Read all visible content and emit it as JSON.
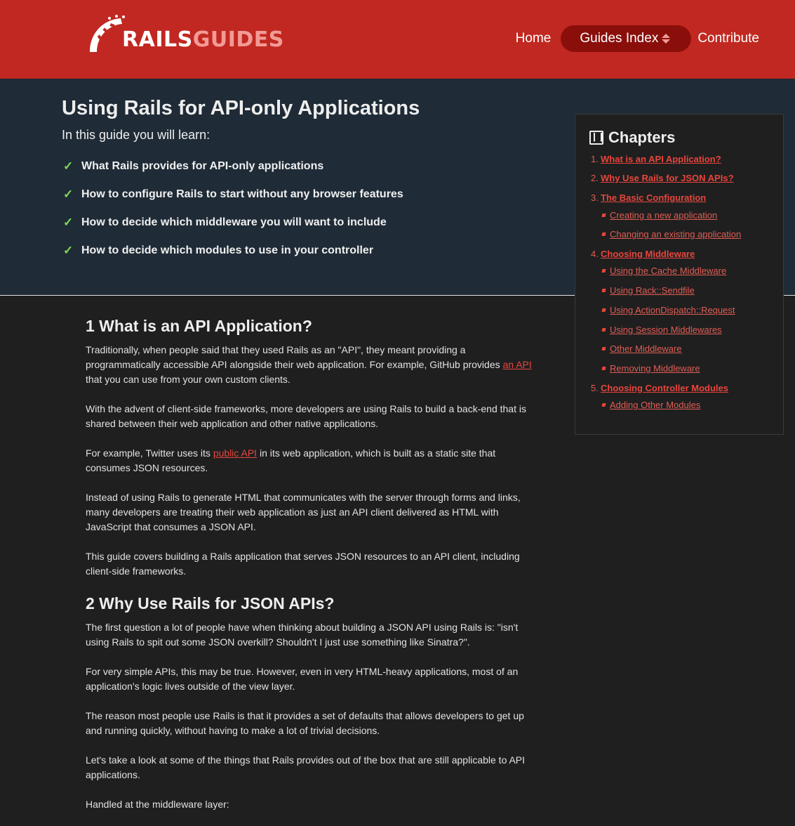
{
  "header": {
    "logo_rails": "RAILS",
    "logo_guides": "GUIDES",
    "nav": {
      "home": "Home",
      "guides_index": "Guides Index",
      "contribute": "Contribute"
    }
  },
  "intro": {
    "title": "Using Rails for API-only Applications",
    "lead": "In this guide you will learn:",
    "items": [
      "What Rails provides for API-only applications",
      "How to configure Rails to start without any browser features",
      "How to decide which middleware you will want to include",
      "How to decide which modules to use in your controller"
    ]
  },
  "chapters": {
    "title": "Chapters",
    "items": [
      {
        "num": "1.",
        "label": "What is an API Application?"
      },
      {
        "num": "2.",
        "label": "Why Use Rails for JSON APIs?"
      },
      {
        "num": "3.",
        "label": "The Basic Configuration"
      },
      {
        "label": "Creating a new application"
      },
      {
        "label": "Changing an existing application"
      },
      {
        "num": "4.",
        "label": "Choosing Middleware"
      },
      {
        "label": "Using the Cache Middleware"
      },
      {
        "label": "Using Rack::Sendfile"
      },
      {
        "label": "Using ActionDispatch::Request"
      },
      {
        "label": "Using Session Middlewares"
      },
      {
        "label": "Other Middleware"
      },
      {
        "label": "Removing Middleware"
      },
      {
        "num": "5.",
        "label": "Choosing Controller Modules"
      },
      {
        "label": "Adding Other Modules"
      }
    ]
  },
  "content": {
    "s1_heading": "1 What is an API Application?",
    "s1_p1_a": "Traditionally, when people said that they used Rails as an \"API\", they meant providing a programmatically accessible API alongside their web application. For example, GitHub provides ",
    "s1_p1_link": "an API",
    "s1_p1_b": " that you can use from your own custom clients.",
    "s1_p2": "With the advent of client-side frameworks, more developers are using Rails to build a back-end that is shared between their web application and other native applications.",
    "s1_p3_a": "For example, Twitter uses its ",
    "s1_p3_link": "public API",
    "s1_p3_b": " in its web application, which is built as a static site that consumes JSON resources.",
    "s1_p4": "Instead of using Rails to generate HTML that communicates with the server through forms and links, many developers are treating their web application as just an API client delivered as HTML with JavaScript that consumes a JSON API.",
    "s1_p5": "This guide covers building a Rails application that serves JSON resources to an API client, including client-side frameworks.",
    "s2_heading": "2 Why Use Rails for JSON APIs?",
    "s2_p1": "The first question a lot of people have when thinking about building a JSON API using Rails is: \"isn't using Rails to spit out some JSON overkill? Shouldn't I just use something like Sinatra?\".",
    "s2_p2": "For very simple APIs, this may be true. However, even in very HTML-heavy applications, most of an application's logic lives outside of the view layer.",
    "s2_p3": "The reason most people use Rails is that it provides a set of defaults that allows developers to get up and running quickly, without having to make a lot of trivial decisions.",
    "s2_p4": "Let's take a look at some of the things that Rails provides out of the box that are still applicable to API applications.",
    "s2_p5": "Handled at the middleware layer:"
  }
}
